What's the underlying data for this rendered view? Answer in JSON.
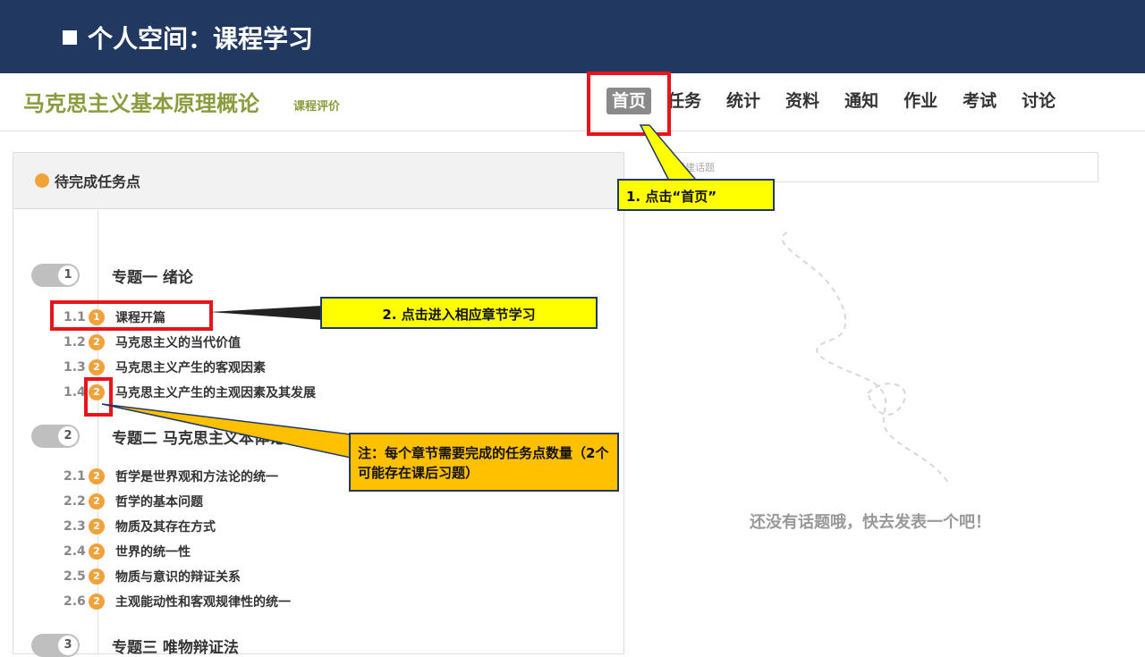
{
  "slide": {
    "title": "个人空间：课程学习"
  },
  "course": {
    "title": "马克思主义基本原理概论",
    "eval_link": "课程评价"
  },
  "nav": [
    "首页",
    "任务",
    "统计",
    "资料",
    "通知",
    "作业",
    "考试",
    "讨论"
  ],
  "panel": {
    "title": "待完成任务点"
  },
  "topics": [
    {
      "num": "1",
      "title": "专题一 绪论",
      "chapters": [
        {
          "num": "1.1",
          "badge": "1",
          "label": "课程开篇"
        },
        {
          "num": "1.2",
          "badge": "2",
          "label": "马克思主义的当代价值"
        },
        {
          "num": "1.3",
          "badge": "2",
          "label": "马克思主义产生的客观因素"
        },
        {
          "num": "1.4",
          "badge": "2",
          "label": "马克思主义产生的主观因素及其发展"
        }
      ]
    },
    {
      "num": "2",
      "title": "专题二 马克思主义本体论",
      "chapters": [
        {
          "num": "2.1",
          "badge": "2",
          "label": "哲学是世界观和方法论的统一"
        },
        {
          "num": "2.2",
          "badge": "2",
          "label": "哲学的基本问题"
        },
        {
          "num": "2.3",
          "badge": "2",
          "label": "物质及其存在方式"
        },
        {
          "num": "2.4",
          "badge": "2",
          "label": "世界的统一性"
        },
        {
          "num": "2.5",
          "badge": "2",
          "label": "物质与意识的辩证关系"
        },
        {
          "num": "2.6",
          "badge": "2",
          "label": "主观能动性和客观规律性的统一"
        }
      ]
    },
    {
      "num": "3",
      "title": "专题三 唯物辩证法",
      "chapters": []
    }
  ],
  "discussion": {
    "placeholder": "新建话题",
    "empty_message": "还没有话题哦，快去发表一个吧！"
  },
  "callouts": {
    "home": "1. 点击“首页”",
    "chapter": "2. 点击进入相应章节学习",
    "note": "注：每个章节需要完成的任务点数量（2个可能存在课后习题）"
  },
  "colors": {
    "banner": "#213860",
    "course_title": "#8a9c3d",
    "badge": "#f2a23a",
    "highlight": "#e8141b",
    "callout_yellow": "#ffff00",
    "callout_orange": "#ffc000"
  }
}
